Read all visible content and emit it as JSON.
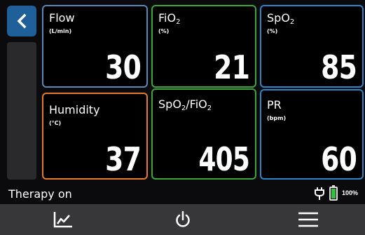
{
  "tiles": {
    "flow": {
      "label": "Flow",
      "unit": "(L/min)",
      "value": "30"
    },
    "fio2": {
      "label_main": "FiO",
      "label_sub": "2",
      "unit": "(%)",
      "value": "21"
    },
    "spo2": {
      "label_main": "SpO",
      "label_sub": "2",
      "unit": "(%)",
      "value": "85"
    },
    "humidity": {
      "label": "Humidity",
      "unit": "(°C)",
      "value": "37"
    },
    "spo2_fio2": {
      "label_a": "SpO",
      "label_a_sub": "2",
      "label_b": "/FiO",
      "label_b_sub": "2",
      "value": "405"
    },
    "pr": {
      "label": "PR",
      "unit": "(bpm)",
      "value": "60"
    }
  },
  "status": {
    "text": "Therapy on",
    "battery_percent": "100%"
  },
  "colors": {
    "flow_border": "#5a86b8",
    "fio2_border": "#3da53a",
    "spo2_border": "#2b86c9",
    "humidity_border": "#e8782a",
    "spo2_fio2_border": "#3da53a",
    "pr_border": "#2b86c9",
    "back_button": "#1f5f9a",
    "battery_fill": "#2ec43a"
  },
  "icons": {
    "back": "chevron-left-icon",
    "plug": "plug-icon",
    "battery": "battery-icon",
    "trend": "trend-chart-icon",
    "power": "power-icon",
    "menu": "hamburger-menu-icon"
  }
}
